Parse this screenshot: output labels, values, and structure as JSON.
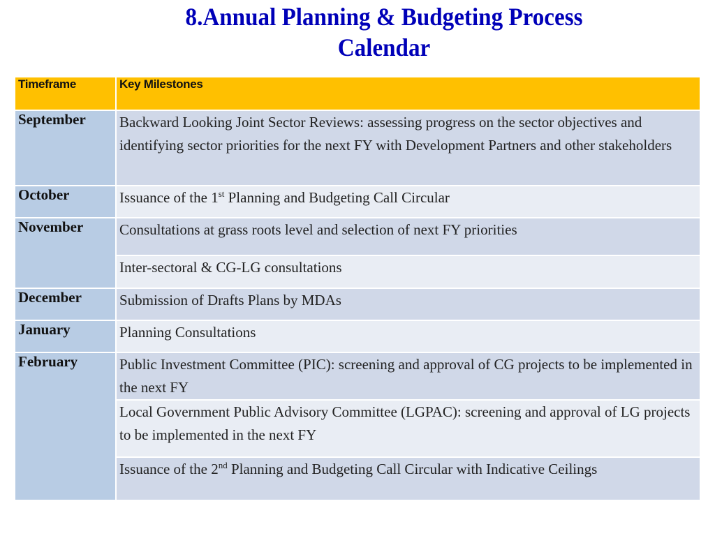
{
  "title": {
    "line1": "8.Annual Planning & Budgeting Process",
    "line2": "Calendar"
  },
  "colors": {
    "title": "#0000b8",
    "header_bg": "#ffc000",
    "timeframe_bg": "#b8cce4",
    "row_dark": "#d0d8e8",
    "row_light": "#e9edf4"
  },
  "table": {
    "headers": [
      "Timeframe",
      "Key Milestones"
    ],
    "rows": [
      {
        "month": "September",
        "milestones": [
          {
            "text": "Backward Looking Joint Sector Reviews: assessing progress on the sector objectives and identifying sector priorities for the next FY with Development Partners and other stakeholders"
          }
        ]
      },
      {
        "month": "October",
        "milestones": [
          {
            "pre": "Issuance of the 1",
            "sup": "st",
            "post": " Planning and Budgeting Call Circular"
          }
        ]
      },
      {
        "month": "November",
        "milestones": [
          {
            "text": "Consultations at grass roots level and selection of next FY priorities"
          },
          {
            "text": "Inter-sectoral & CG-LG consultations"
          }
        ]
      },
      {
        "month": "December",
        "milestones": [
          {
            "text": "Submission of Drafts Plans by MDAs"
          }
        ]
      },
      {
        "month": "January",
        "milestones": [
          {
            "text": "Planning Consultations"
          }
        ]
      },
      {
        "month": "February",
        "milestones": [
          {
            "text": "Public Investment Committee (PIC): screening and approval of CG projects to be implemented in the next FY"
          },
          {
            "text": "Local Government Public Advisory Committee (LGPAC): screening and approval of LG projects to be implemented in the next FY"
          },
          {
            "pre": "Issuance of the 2",
            "sup": "nd",
            "post": " Planning and Budgeting Call Circular with Indicative Ceilings"
          }
        ]
      }
    ]
  }
}
